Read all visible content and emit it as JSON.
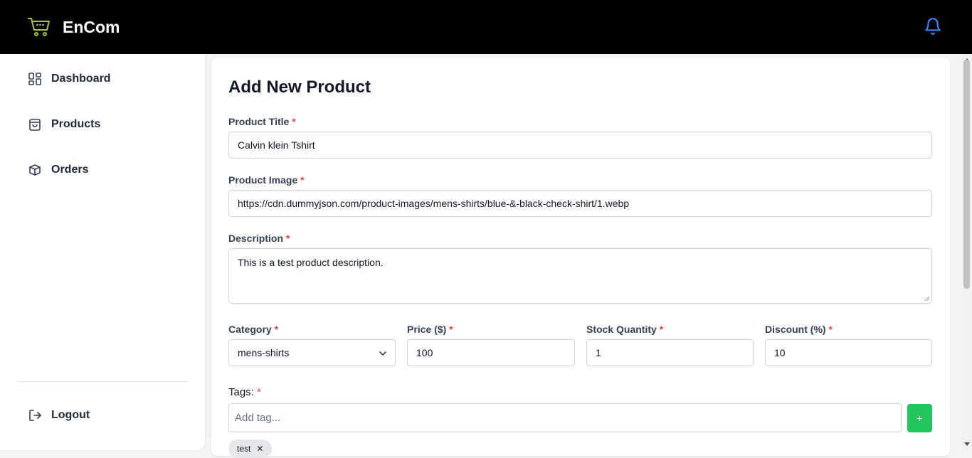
{
  "app": {
    "name": "EnCom",
    "accent_color": "#3b82f6",
    "logo_color": "#a3c93a"
  },
  "sidebar": {
    "items": [
      {
        "label": "Dashboard",
        "icon": "grid-icon"
      },
      {
        "label": "Products",
        "icon": "shopping-bag-icon"
      },
      {
        "label": "Orders",
        "icon": "box-icon"
      }
    ],
    "logout": {
      "label": "Logout",
      "icon": "logout-icon"
    }
  },
  "form": {
    "title": "Add New Product",
    "required_marker": "*",
    "product_title": {
      "label": "Product Title",
      "value": "Calvin klein Tshirt"
    },
    "product_image": {
      "label": "Product Image",
      "value": "https://cdn.dummyjson.com/product-images/mens-shirts/blue-&-black-check-shirt/1.webp"
    },
    "description": {
      "label": "Description",
      "value": "This is a test product description."
    },
    "category": {
      "label": "Category",
      "value": "mens-shirts"
    },
    "price": {
      "label": "Price ($)",
      "value": "100"
    },
    "stock": {
      "label": "Stock Quantity",
      "value": "1"
    },
    "discount": {
      "label": "Discount (%)",
      "value": "10"
    },
    "tags": {
      "label": "Tags:",
      "placeholder": "Add tag...",
      "add_button": "+",
      "items": [
        "test"
      ],
      "remove_glyph": "✕"
    }
  }
}
